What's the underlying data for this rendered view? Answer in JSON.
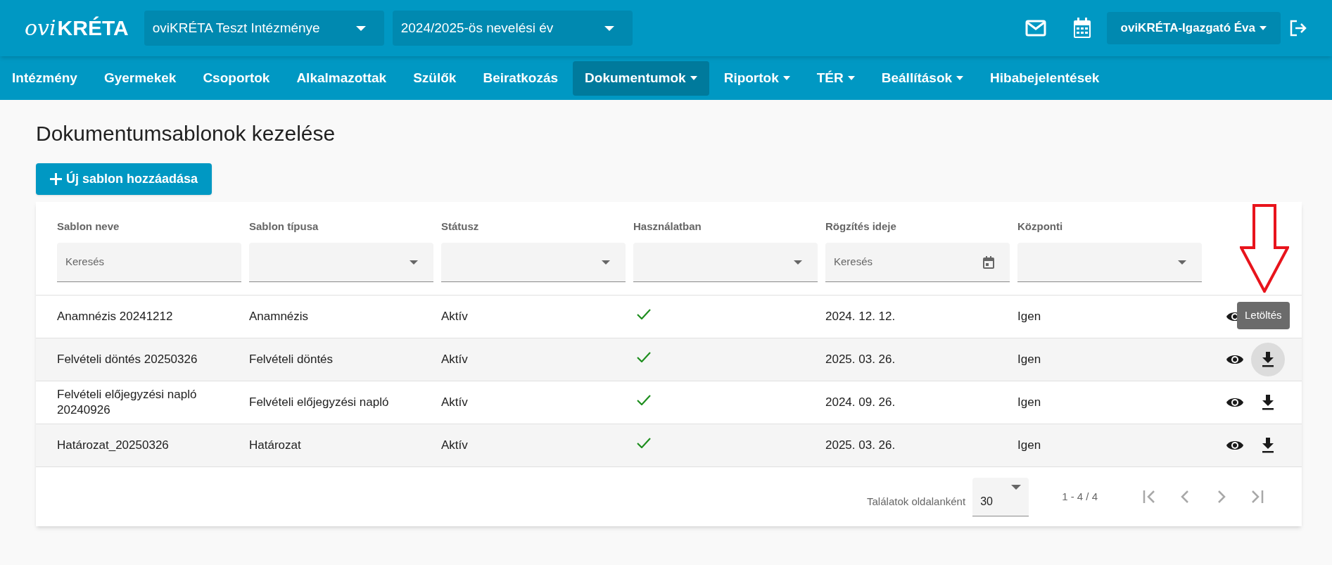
{
  "header": {
    "logo": {
      "part_1": "ovi",
      "part_2": "KRÉTA"
    },
    "selectors": [
      {
        "value": "oviKRÉTA Teszt Intézménye"
      },
      {
        "value": "2024/2025-ös nevelési év"
      }
    ],
    "user_menu": "oviKRÉTA-Igazgató Éva"
  },
  "nav": [
    {
      "label": "Intézmény",
      "dropdown": false,
      "selected": false
    },
    {
      "label": "Gyermekek",
      "dropdown": false,
      "selected": false
    },
    {
      "label": "Csoportok",
      "dropdown": false,
      "selected": false
    },
    {
      "label": "Alkalmazottak",
      "dropdown": false,
      "selected": false
    },
    {
      "label": "Szülők",
      "dropdown": false,
      "selected": false
    },
    {
      "label": "Beiratkozás",
      "dropdown": false,
      "selected": false
    },
    {
      "label": "Dokumentumok",
      "dropdown": true,
      "selected": true
    },
    {
      "label": "Riportok",
      "dropdown": true,
      "selected": false
    },
    {
      "label": "TÉR",
      "dropdown": true,
      "selected": false
    },
    {
      "label": "Beállítások",
      "dropdown": true,
      "selected": false
    },
    {
      "label": "Hibabejelentések",
      "dropdown": false,
      "selected": false
    }
  ],
  "page_title": "Dokumentumsablonok kezelése",
  "add_button": "Új sablon hozzáadása",
  "table": {
    "columns": [
      {
        "label": "Sablon neve",
        "filter": {
          "kind": "text",
          "placeholder": "Keresés"
        }
      },
      {
        "label": "Sablon típusa",
        "filter": {
          "kind": "select"
        }
      },
      {
        "label": "Státusz",
        "filter": {
          "kind": "select"
        }
      },
      {
        "label": "Használatban",
        "filter": {
          "kind": "select"
        }
      },
      {
        "label": "Rögzítés ideje",
        "filter": {
          "kind": "date",
          "placeholder": "Keresés"
        }
      },
      {
        "label": "Központi",
        "filter": {
          "kind": "select"
        }
      }
    ],
    "rows": [
      {
        "name": "Anamnézis 20241212",
        "type": "Anamnézis",
        "status": "Aktív",
        "in_use": true,
        "date": "2024. 12. 12.",
        "central": "Igen",
        "download_hovered": false,
        "tooltip": "Letöltés"
      },
      {
        "name": "Felvételi döntés 20250326",
        "type": "Felvételi döntés",
        "status": "Aktív",
        "in_use": true,
        "date": "2025. 03. 26.",
        "central": "Igen",
        "download_hovered": true
      },
      {
        "name": "Felvételi előjegyzési napló 20240926",
        "type": "Felvételi előjegyzési napló",
        "status": "Aktív",
        "in_use": true,
        "date": "2024. 09. 26.",
        "central": "Igen",
        "download_hovered": false
      },
      {
        "name": "Határozat_20250326",
        "type": "Határozat",
        "status": "Aktív",
        "in_use": true,
        "date": "2025. 03. 26.",
        "central": "Igen",
        "download_hovered": false
      }
    ],
    "footer": {
      "per_page_label": "Találatok oldalanként",
      "per_page_value": "30",
      "range": "1 - 4 / 4"
    }
  }
}
